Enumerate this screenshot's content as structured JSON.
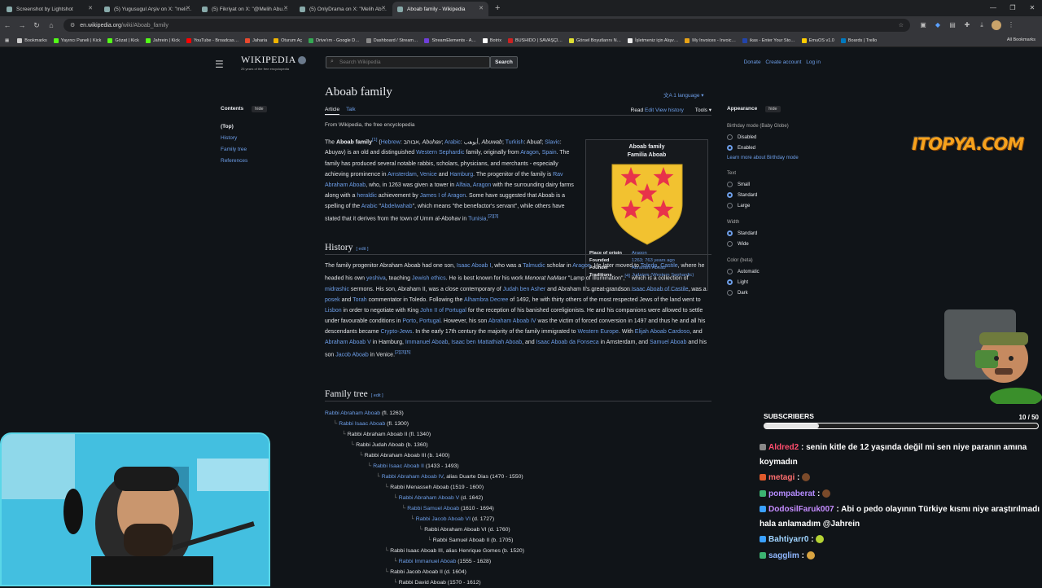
{
  "browser": {
    "tabs": [
      {
        "title": "Screenshot by Lightshot",
        "active": false
      },
      {
        "title": "(5) Yugusugul Arşiv on X: \"meli…",
        "active": false
      },
      {
        "title": "(5) Fikriyat on X: \"@Melih Abu…",
        "active": false
      },
      {
        "title": "(5) OnlyDrama on X: \"Melih Ab…",
        "active": false
      },
      {
        "title": "Aboab family - Wikipedia",
        "active": true
      }
    ],
    "url_host": "en.wikipedia.org",
    "url_path": "/wiki/Aboab_family",
    "bookmarks": [
      {
        "label": "Bookmarks",
        "color": "#cccccc"
      },
      {
        "label": "Yayıncı Paneli | Kick",
        "color": "#53fc18"
      },
      {
        "label": "Gözat | Kick",
        "color": "#53fc18"
      },
      {
        "label": "Jahrein | Kick",
        "color": "#53fc18"
      },
      {
        "label": "YouTube - Broadcas…",
        "color": "#ff0000"
      },
      {
        "label": "Jaharia",
        "color": "#e84a2f"
      },
      {
        "label": "Oturum Aç",
        "color": "#f0b400"
      },
      {
        "label": "Drive'ım - Google D…",
        "color": "#34a853"
      },
      {
        "label": "Dashboard / Stream…",
        "color": "#888888"
      },
      {
        "label": "StreamElements - A…",
        "color": "#6f3fd9"
      },
      {
        "label": "Botrix",
        "color": "#ffffff"
      },
      {
        "label": "BUSHIDO | SAVAŞÇI…",
        "color": "#cc2222"
      },
      {
        "label": "Görsel Boyutlarını N…",
        "color": "#dddd33"
      },
      {
        "label": "İşletmeniz için Alışv…",
        "color": "#eeeeee"
      },
      {
        "label": "My Invoices - Invoic…",
        "color": "#e8a317"
      },
      {
        "label": "ikas - Enter Your Sto…",
        "color": "#2244aa"
      },
      {
        "label": "EmuOS v1.0",
        "color": "#ffcc00"
      },
      {
        "label": "Boards | Trello",
        "color": "#0079bf"
      }
    ],
    "all_bookmarks": "All Bookmarks"
  },
  "wiki": {
    "logo_name": "WIKIPEDIA",
    "logo_tag": "25 years of the free encyclopedia",
    "search_placeholder": "Search Wikipedia",
    "search_button": "Search",
    "donate": "Donate",
    "create_account": "Create account",
    "log_in": "Log in",
    "toc": {
      "title": "Contents",
      "hide": "hide",
      "items": [
        "(Top)",
        "History",
        "Family tree",
        "References"
      ]
    },
    "title": "Aboab family",
    "languages": "1 language",
    "tabs_left": [
      "Article",
      "Talk"
    ],
    "tabs_right": [
      "Read",
      "Edit",
      "View history",
      "Tools"
    ],
    "from": "From Wikipedia, the free encyclopedia",
    "history_heading": "History",
    "tree_heading": "Family tree",
    "edit": "[ edit ]",
    "infobox": {
      "title": "Aboab family",
      "subtitle": "Familia Aboab",
      "rows": [
        {
          "label": "Place of origin",
          "value": "Aragon"
        },
        {
          "label": "Founded",
          "value": "1263; 763 years ago"
        },
        {
          "label": "Founder",
          "value": "Abraham Aboab"
        },
        {
          "label": "Traditions",
          "value": "Judaism (Western Sephardic)"
        }
      ],
      "shield_color": "#f2c230",
      "star_color": "#e8334a"
    },
    "tree": [
      {
        "indent": 0,
        "text": "Rabbi Abraham Aboab",
        "note": " (fl. 1263)",
        "link": true
      },
      {
        "indent": 1,
        "text": "Rabbi Isaac Aboab",
        "note": " (fl. 1300)",
        "link": true
      },
      {
        "indent": 2,
        "text": "Rabbi Abraham Aboab II",
        "note": " (fl. 1340)",
        "link": false
      },
      {
        "indent": 3,
        "text": "Rabbi Judah Aboab",
        "note": " (b. 1360)",
        "link": false
      },
      {
        "indent": 4,
        "text": "Rabbi Abraham Aboab III",
        "note": " (b. 1400)",
        "link": false
      },
      {
        "indent": 5,
        "text": "Rabbi Isaac Aboab II",
        "note": " (1433 - 1493)",
        "link": true
      },
      {
        "indent": 6,
        "text": "Rabbi Abraham Aboab IV",
        "note": ", alias Duarte Dias (1470 - 1550)",
        "link": true
      },
      {
        "indent": 7,
        "text": "Rabbi Menasseh Aboab",
        "note": " (1519 - 1600)",
        "link": false
      },
      {
        "indent": 8,
        "text": "Rabbi Abraham Aboab V",
        "note": " (d. 1642)",
        "link": true
      },
      {
        "indent": 9,
        "text": "Rabbi Samuel Aboab",
        "note": " (1610 - 1694)",
        "link": true
      },
      {
        "indent": 10,
        "text": "Rabbi Jacob Aboab VI",
        "note": " (d. 1727)",
        "link": true
      },
      {
        "indent": 11,
        "text": "Rabbi Abraham Aboab VI",
        "note": " (d. 1760)",
        "link": false
      },
      {
        "indent": 12,
        "text": "Rabbi Samuel Aboab II",
        "note": " (b. 1705)",
        "link": false
      },
      {
        "indent": 7,
        "text": "Rabbi Isaac Aboab III, alias Henrique Gomes",
        "note": " (b. 1520)",
        "link": false
      },
      {
        "indent": 8,
        "text": "Rabbi Immanuel Aboab",
        "note": " (1555 - 1628)",
        "link": true
      },
      {
        "indent": 7,
        "text": "Rabbi Jacob Aboab II",
        "note": " (d. 1604)",
        "link": false
      },
      {
        "indent": 8,
        "text": "Rabbi David Aboab",
        "note": " (1570 - 1612)",
        "link": false
      }
    ],
    "appearance": {
      "title": "Appearance",
      "hide": "hide",
      "birthday_label": "Birthday mode (Baby Globe)",
      "birthday_options": [
        "Disabled",
        "Enabled"
      ],
      "birthday_selected": 1,
      "learn_more": "Learn more about Birthday mode",
      "text_label": "Text",
      "text_options": [
        "Small",
        "Standard",
        "Large"
      ],
      "text_selected": 1,
      "width_label": "Width",
      "width_options": [
        "Standard",
        "Wide"
      ],
      "width_selected": 0,
      "color_label": "Color (beta)",
      "color_options": [
        "Automatic",
        "Light",
        "Dark"
      ],
      "color_selected": 1
    }
  },
  "stream": {
    "sponsor": "ITOPYA.COM",
    "subs_label": "SUBSCRIBERS",
    "subs_count": "10 / 50",
    "subs_progress": 0.2,
    "chat": [
      {
        "user": "Aldred2",
        "color": "#ff4d6d",
        "badge": "#888888",
        "text": "senin kitle de 12 yaşında değil mi sen niye paranın amına koymadın",
        "emote": ""
      },
      {
        "user": "metagi",
        "color": "#ff6f6f",
        "badge": "#e05a2b",
        "text": "",
        "emote": "#7a4a2a"
      },
      {
        "user": "pompaberat",
        "color": "#b58cff",
        "badge": "#3cb371",
        "text": "",
        "emote": "#7a4a2a"
      },
      {
        "user": "DodosilFaruk007",
        "color": "#c58cff",
        "badge": "#3aa0ff",
        "text": "Abi o pedo olayının Türkiye kısmı niye araştırılmadı hala anlamadım @Jahrein",
        "emote": ""
      },
      {
        "user": "Bahtiyarr0",
        "color": "#9fd3ff",
        "badge": "#3aa0ff",
        "text": "",
        "emote": "#b5d334"
      },
      {
        "user": "sagglim",
        "color": "#8fb7ff",
        "badge": "#3cb371",
        "text": "",
        "emote": "#d9a441"
      }
    ]
  }
}
